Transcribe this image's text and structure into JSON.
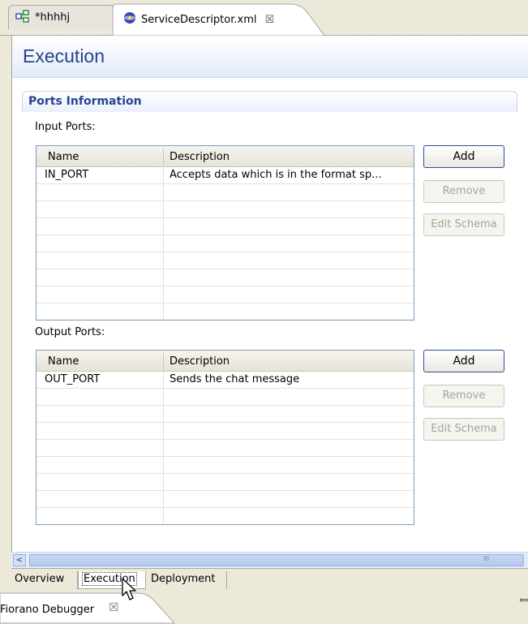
{
  "tabs": [
    {
      "label": "*hhhhj",
      "icon": "component-icon"
    },
    {
      "label": "ServiceDescriptor.xml",
      "icon": "xml-editor-icon",
      "close": "☒"
    }
  ],
  "header": {
    "title": "Execution"
  },
  "section": {
    "title": "Ports Information"
  },
  "input_ports": {
    "label": "Input Ports:",
    "columns": [
      "Name",
      "Description"
    ],
    "rows": [
      {
        "name": "IN_PORT",
        "description": "Accepts data which is in the format sp..."
      }
    ],
    "buttons": {
      "add": "Add",
      "remove": "Remove",
      "edit_schema": "Edit Schema"
    }
  },
  "output_ports": {
    "label": "Output Ports:",
    "columns": [
      "Name",
      "Description"
    ],
    "rows": [
      {
        "name": "OUT_PORT",
        "description": "Sends the chat message"
      }
    ],
    "buttons": {
      "add": "Add",
      "remove": "Remove",
      "edit_schema": "Edit Schema"
    }
  },
  "scrollbar": {
    "left_arrow": "<",
    "grip": "III"
  },
  "page_tabs": [
    {
      "label": "Overview",
      "active": false
    },
    {
      "label": "Execution",
      "active": true
    },
    {
      "label": "Deployment",
      "active": false
    }
  ],
  "view": {
    "label": "Fiorano Debugger",
    "close": "☒"
  },
  "colors": {
    "title_blue": "#27448c",
    "border": "#7f9db9",
    "background": "#ece9d8"
  }
}
